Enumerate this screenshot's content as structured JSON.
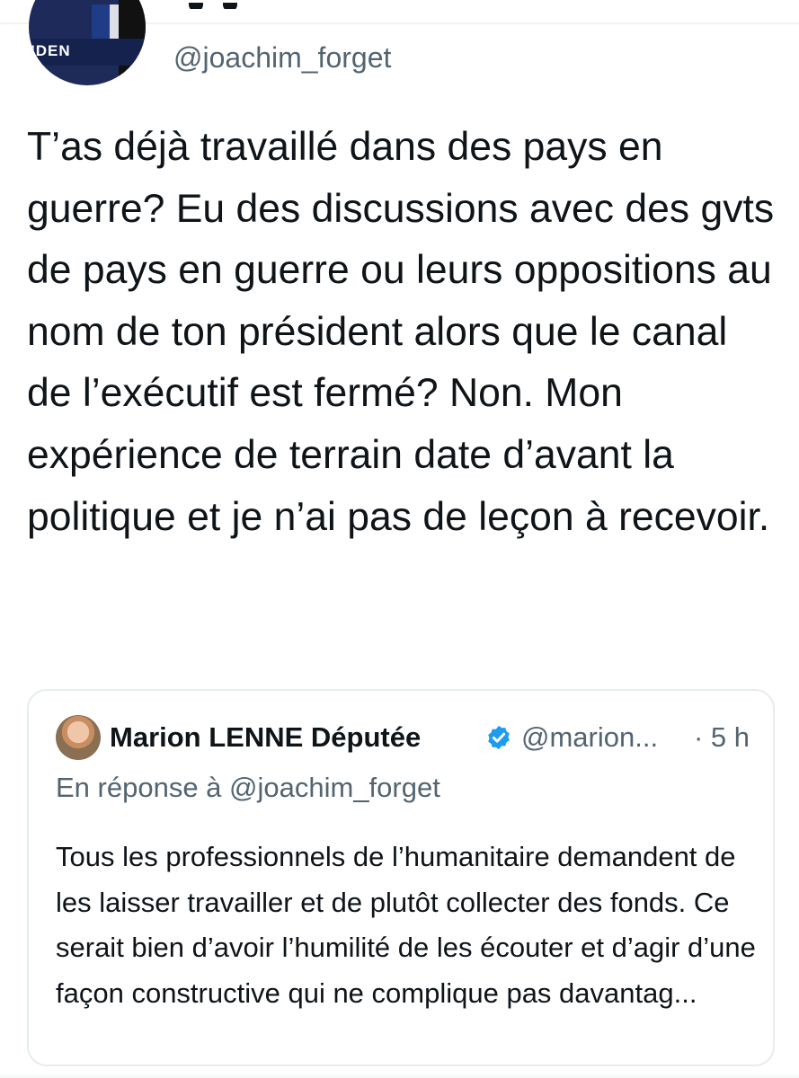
{
  "tweet": {
    "handle": "@joachim_forget",
    "text": "T’as déjà travaillé dans des pays en guerre? Eu des discussions avec des gvts de pays en guerre ou leurs oppositions au nom de ton président alors que le canal de l’exécutif est fermé? Non. Mon expérience de terrain date d’avant la politique et je n’ai pas de leçon à recevoir.",
    "avatar_sign_text": "IDEN"
  },
  "quoted_tweet": {
    "author_name": "Marion LENNE Députée",
    "handle": "@marion...",
    "time": "· 5 h",
    "reply_context": "En réponse à @joachim_forget",
    "text": "Tous les professionnels de l’humanitaire demandent de les laisser travailler et de plutôt collecter des fonds. Ce serait bien d’avoir l’humilité de les écouter et d’agir d’une façon constructive qui ne complique pas davantag..."
  },
  "colors": {
    "text_primary": "#0f1419",
    "text_secondary": "#536471",
    "verified": "#1d9bf0",
    "border": "#e6ecf0"
  },
  "icons": {
    "verified": "verified-badge-icon"
  }
}
